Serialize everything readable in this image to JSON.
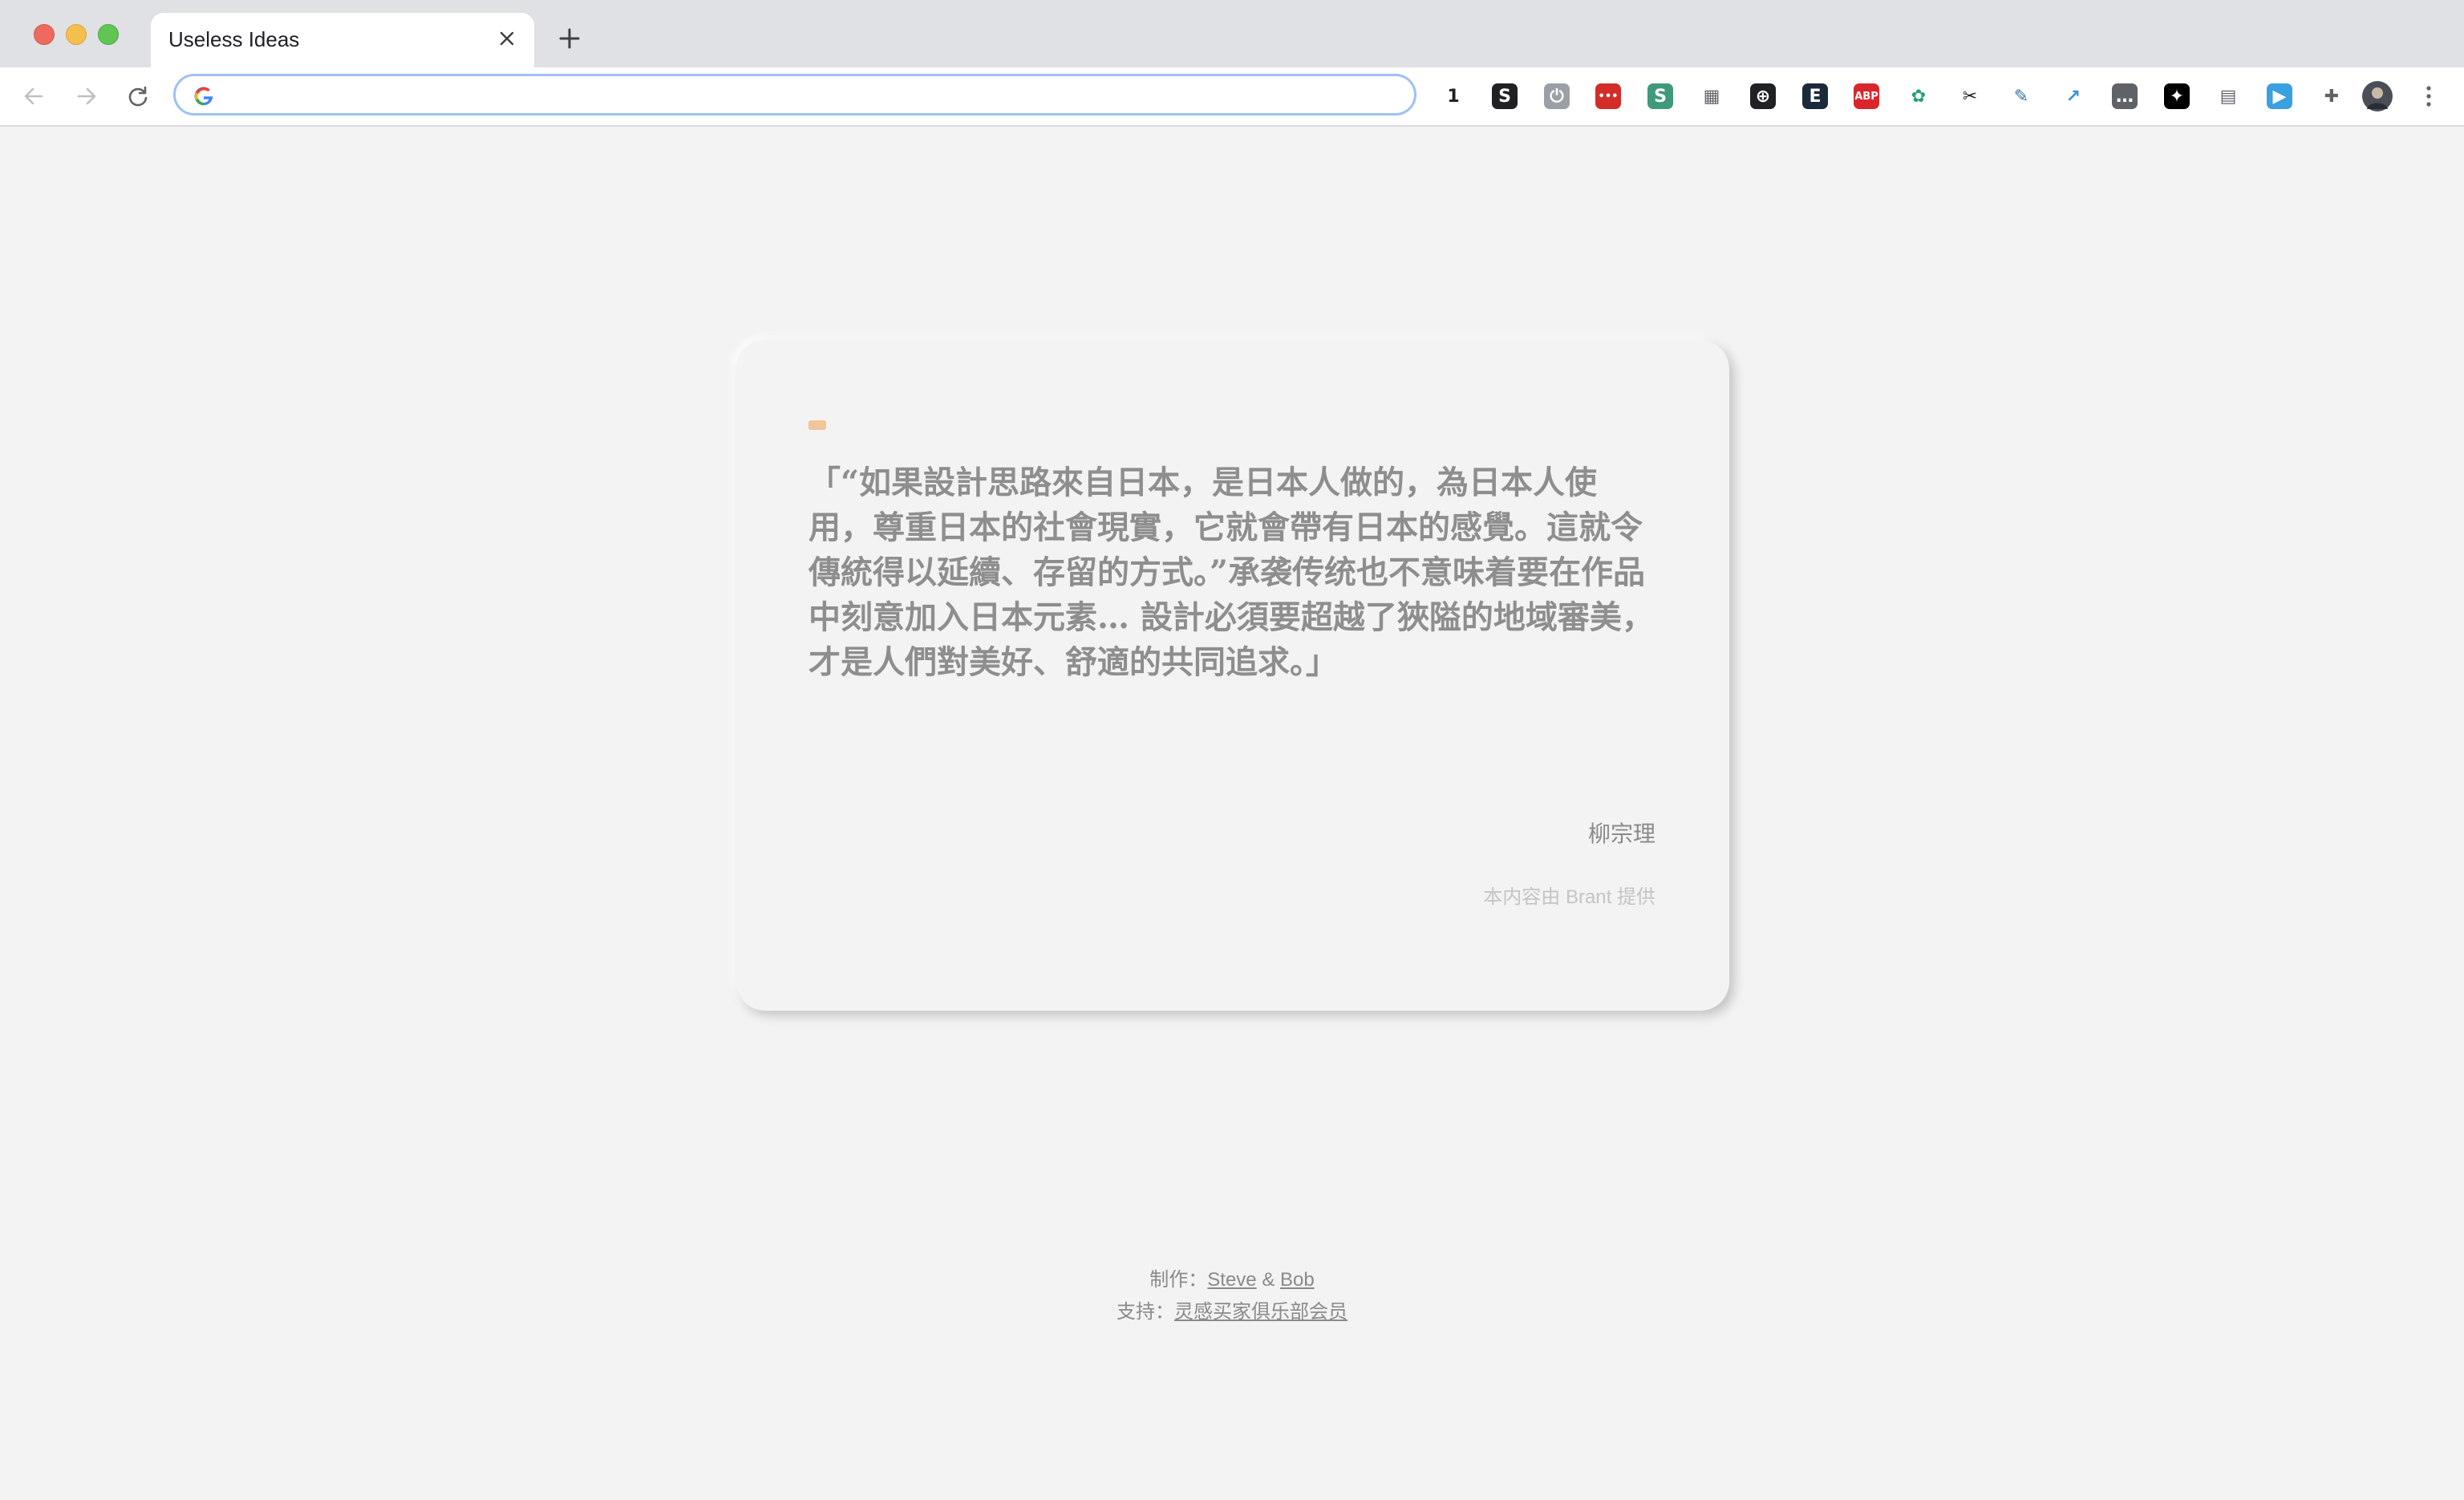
{
  "browser": {
    "tab_title": "Useless Ideas",
    "omnibox": {
      "value": "",
      "placeholder": ""
    },
    "extensions": [
      {
        "name": "onepassword-icon",
        "glyph": "1",
        "bg": "",
        "fg": "#202124"
      },
      {
        "name": "smartsave-icon",
        "glyph": "S",
        "bg": "#202124",
        "fg": "#ffffff"
      },
      {
        "name": "power-icon",
        "glyph": "⏻",
        "bg": "#9aa0a6",
        "fg": "#ffffff"
      },
      {
        "name": "lastpass-icon",
        "glyph": "•••",
        "bg": "#d32d27",
        "fg": "#ffffff"
      },
      {
        "name": "scribe-icon",
        "glyph": "S",
        "bg": "#3e9a7a",
        "fg": "#ffffff"
      },
      {
        "name": "dashboard-icon",
        "glyph": "▦",
        "bg": "",
        "fg": "#5f6368"
      },
      {
        "name": "dribbble-icon",
        "glyph": "⊕",
        "bg": "#202124",
        "fg": "#ffffff"
      },
      {
        "name": "evernote-e-icon",
        "glyph": "E",
        "bg": "#1b2a3a",
        "fg": "#ffffff"
      },
      {
        "name": "adblock-plus-icon",
        "glyph": "ABP",
        "bg": "#d9262c",
        "fg": "#ffffff"
      },
      {
        "name": "chatgpt-icon",
        "glyph": "✿",
        "bg": "",
        "fg": "#26a17b"
      },
      {
        "name": "scissors-icon",
        "glyph": "✂",
        "bg": "",
        "fg": "#202124"
      },
      {
        "name": "highlighter-icon",
        "glyph": "✎",
        "bg": "",
        "fg": "#3b6ea5"
      },
      {
        "name": "share-icon",
        "glyph": "↗",
        "bg": "",
        "fg": "#3b8fd8"
      },
      {
        "name": "chat-bubble-icon",
        "glyph": "…",
        "bg": "#5f6368",
        "fg": "#ffffff"
      },
      {
        "name": "twitter-icon",
        "glyph": "✦",
        "bg": "#000000",
        "fg": "#ffffff"
      },
      {
        "name": "window-icon",
        "glyph": "▤",
        "bg": "",
        "fg": "#5f6368"
      },
      {
        "name": "bilibili-tv-icon",
        "glyph": "▶",
        "bg": "#3aa0e0",
        "fg": "#ffffff"
      },
      {
        "name": "extensions-puzzle-icon",
        "glyph": "✚",
        "bg": "",
        "fg": "#5f6368"
      }
    ]
  },
  "card": {
    "quote": "「“如果設計思路來自日本，是日本人做的，為日本人使用，尊重日本的社會現實，它就會帶有日本的感覺。這就令傳統得以延續、存留的方式。”承袭传统也不意味着要在作品中刻意加入日本元素… 設計必須要超越了狹隘的地域審美，才是人們對美好、舒適的共同追求。」",
    "author": "柳宗理",
    "credit": "本内容由 Brant 提供"
  },
  "footer": {
    "made_by_label": "制作：",
    "maker1": "Steve",
    "amp": " & ",
    "maker2": "Bob",
    "support_label": "支持：",
    "supporter": "灵感买家俱乐部会员"
  },
  "colors": {
    "background": "#f3f3f3",
    "quote_text": "#8e8e8e",
    "accent_mark": "#f2c59a"
  }
}
